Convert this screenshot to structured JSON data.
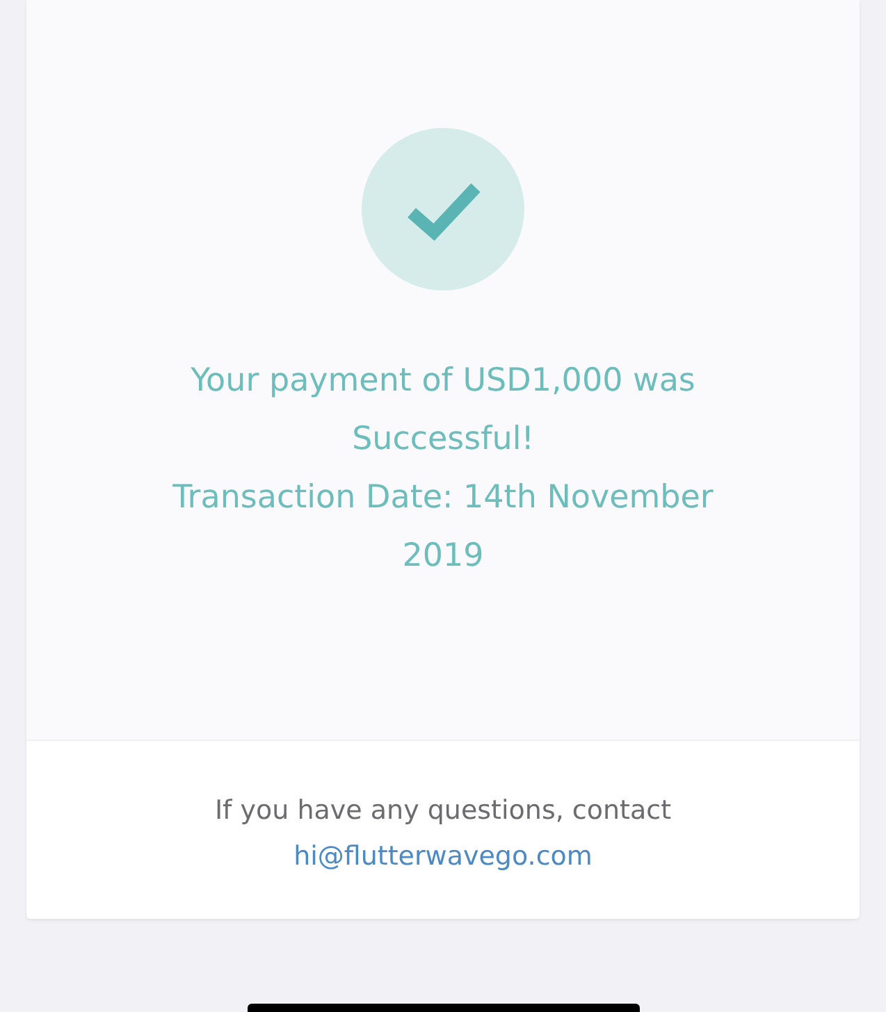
{
  "message": {
    "lines": [
      "Your payment of USD1,000 was Successful!",
      "Transaction Date: 14th November 2019"
    ]
  },
  "footer": {
    "text": "If you have any questions, contact",
    "email": "hi@flutterwavego.com"
  }
}
